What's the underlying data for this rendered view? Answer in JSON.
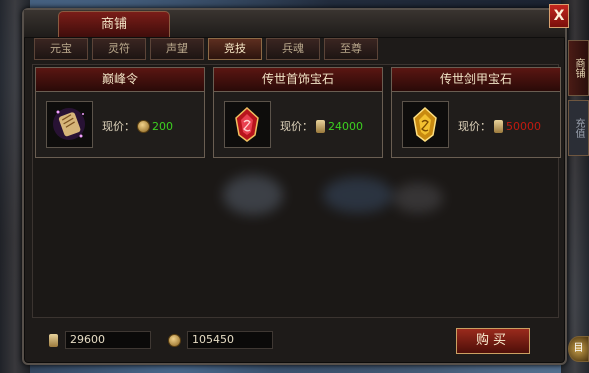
{
  "window": {
    "title": "商铺",
    "close_label": "X"
  },
  "tabs": [
    {
      "label": "元宝"
    },
    {
      "label": "灵符"
    },
    {
      "label": "声望"
    },
    {
      "label": "竞技"
    },
    {
      "label": "兵魂"
    },
    {
      "label": "至尊"
    }
  ],
  "active_tab": "竞技",
  "items": [
    {
      "name": "巅峰令",
      "price_label": "现价：",
      "currency_icon": "coin-icon",
      "price": "200",
      "price_color": "#3cd020"
    },
    {
      "name": "传世首饰宝石",
      "price_label": "现价：",
      "currency_icon": "scroll-icon",
      "price": "24000",
      "price_color": "#3cd020"
    },
    {
      "name": "传世剑甲宝石",
      "price_label": "现价：",
      "currency_icon": "scroll-icon",
      "price": "50000",
      "price_color": "#c01a10"
    }
  ],
  "footer": {
    "scroll_balance": "29600",
    "coin_balance": "105450",
    "buy_label": "购买"
  },
  "side_tabs": [
    {
      "label": "商铺"
    },
    {
      "label": "充值"
    }
  ],
  "side_round_label": "目"
}
